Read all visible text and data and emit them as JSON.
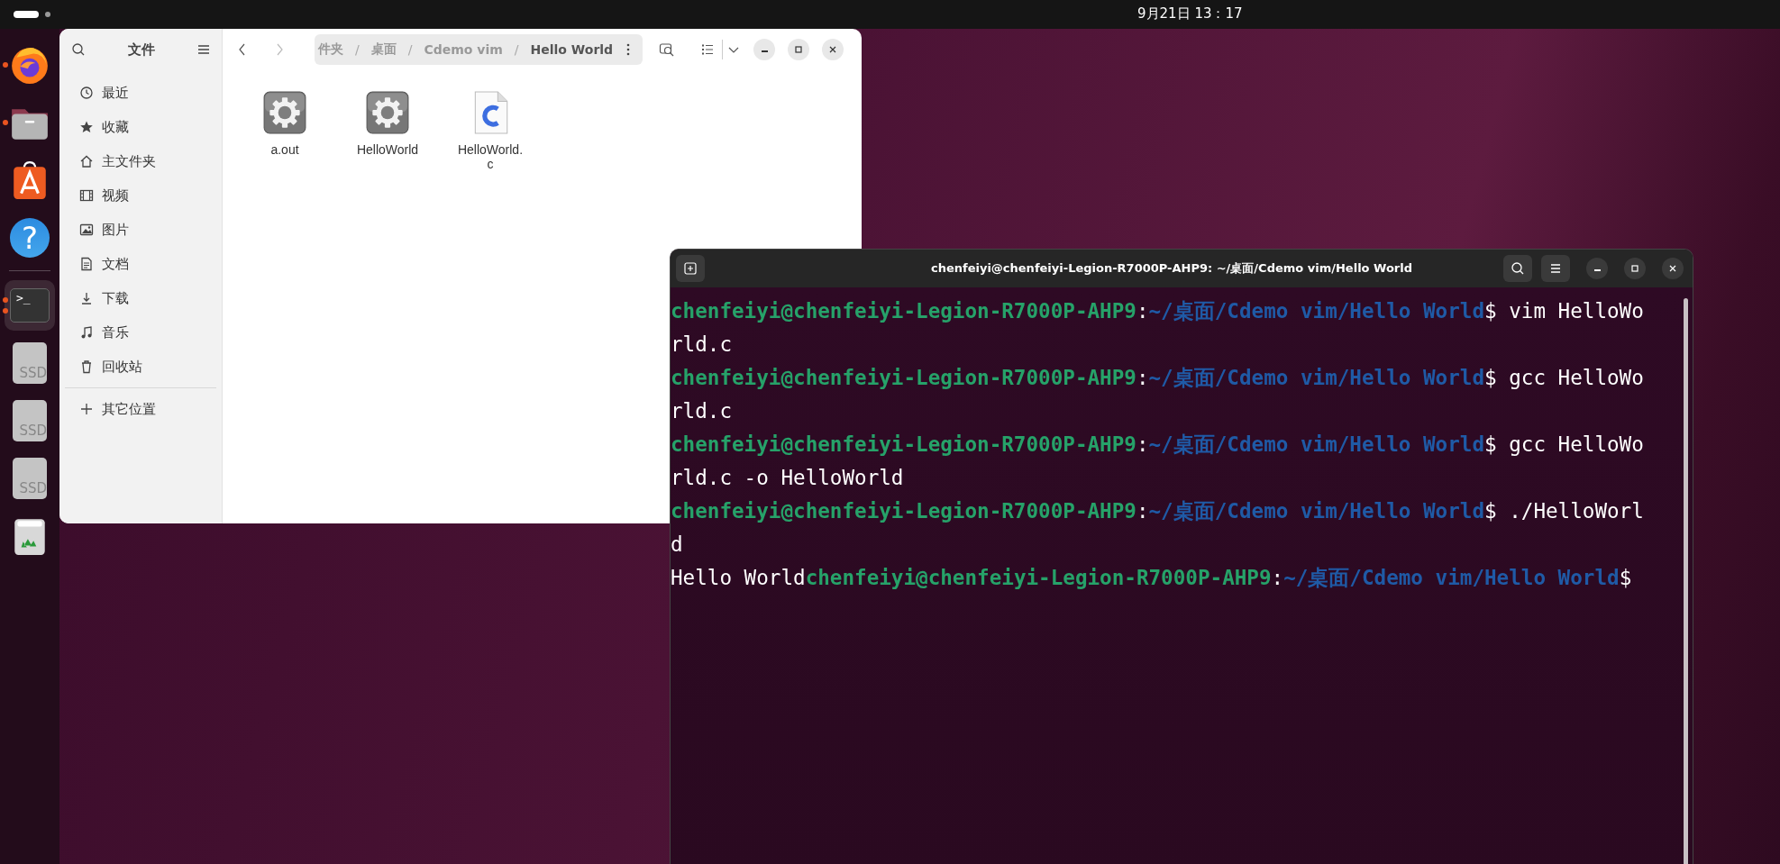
{
  "top_bar": {
    "clock": "9月21日 13：17"
  },
  "dock": {
    "items": [
      {
        "kind": "firefox",
        "running": true,
        "multiple": false,
        "selected": false
      },
      {
        "kind": "files",
        "running": true,
        "multiple": false,
        "selected": false
      },
      {
        "kind": "software",
        "running": false,
        "multiple": false,
        "selected": false
      },
      {
        "kind": "help",
        "glyph": "?",
        "running": false,
        "multiple": false,
        "selected": false
      },
      {
        "kind": "separator"
      },
      {
        "kind": "terminal",
        "glyph": ">_",
        "running": true,
        "multiple": true,
        "selected": true
      },
      {
        "kind": "drive",
        "label": "SSD",
        "running": false,
        "multiple": false,
        "selected": false
      },
      {
        "kind": "drive",
        "label": "SSD",
        "running": false,
        "multiple": false,
        "selected": false
      },
      {
        "kind": "drive",
        "label": "SSD",
        "running": false,
        "multiple": false,
        "selected": false
      },
      {
        "kind": "trash",
        "running": false,
        "multiple": false,
        "selected": false
      }
    ]
  },
  "file_manager": {
    "sidebar_title": "文件",
    "places": [
      {
        "label": "最近",
        "selected": false
      },
      {
        "label": "收藏",
        "selected": false
      },
      {
        "label": "主文件夹",
        "selected": false
      },
      {
        "label": "视频",
        "selected": false
      },
      {
        "label": "图片",
        "selected": false
      },
      {
        "label": "文档",
        "selected": false
      },
      {
        "label": "下载",
        "selected": false
      },
      {
        "label": "音乐",
        "selected": false
      },
      {
        "label": "回收站",
        "selected": false
      }
    ],
    "other_locations": "其它位置",
    "path": [
      {
        "label": "件夹",
        "current": false
      },
      {
        "separator": "/",
        "label": "桌面",
        "current": false
      },
      {
        "separator": "/",
        "label": "Cdemo vim",
        "current": false
      },
      {
        "separator": "/",
        "label": "Hello World",
        "current": true
      }
    ],
    "files": [
      {
        "name": "a.out",
        "kind": "executable"
      },
      {
        "name": "HelloWorld",
        "kind": "executable"
      },
      {
        "name": "HelloWorld.c",
        "kind": "c-source"
      }
    ]
  },
  "terminal": {
    "title": "chenfeiyi@chenfeiyi-Legion-R7000P-AHP9: ~/桌面/Cdemo vim/Hello World",
    "lines": [
      [
        {
          "kind": "user",
          "text": "chenfeiyi@chenfeiyi-Legion-R7000P-AHP9"
        },
        {
          "kind": "plain",
          "text": ":"
        },
        {
          "kind": "path",
          "text": "~/桌面/Cdemo vim/Hello World"
        },
        {
          "kind": "plain",
          "text": "$ vim HelloWo"
        }
      ],
      [
        {
          "kind": "plain",
          "text": "rld.c"
        }
      ],
      [
        {
          "kind": "user",
          "text": "chenfeiyi@chenfeiyi-Legion-R7000P-AHP9"
        },
        {
          "kind": "plain",
          "text": ":"
        },
        {
          "kind": "path",
          "text": "~/桌面/Cdemo vim/Hello World"
        },
        {
          "kind": "plain",
          "text": "$ gcc HelloWo"
        }
      ],
      [
        {
          "kind": "plain",
          "text": "rld.c"
        }
      ],
      [
        {
          "kind": "user",
          "text": "chenfeiyi@chenfeiyi-Legion-R7000P-AHP9"
        },
        {
          "kind": "plain",
          "text": ":"
        },
        {
          "kind": "path",
          "text": "~/桌面/Cdemo vim/Hello World"
        },
        {
          "kind": "plain",
          "text": "$ gcc HelloWo"
        }
      ],
      [
        {
          "kind": "plain",
          "text": "rld.c -o HelloWorld"
        }
      ],
      [
        {
          "kind": "user",
          "text": "chenfeiyi@chenfeiyi-Legion-R7000P-AHP9"
        },
        {
          "kind": "plain",
          "text": ":"
        },
        {
          "kind": "path",
          "text": "~/桌面/Cdemo vim/Hello World"
        },
        {
          "kind": "plain",
          "text": "$ ./HelloWorl"
        }
      ],
      [
        {
          "kind": "plain",
          "text": "d"
        }
      ],
      [
        {
          "kind": "plain",
          "text": "Hello World"
        },
        {
          "kind": "user",
          "text": "chenfeiyi@chenfeiyi-Legion-R7000P-AHP9"
        },
        {
          "kind": "plain",
          "text": ":"
        },
        {
          "kind": "path",
          "text": "~/桌面/Cdemo vim/Hello World"
        },
        {
          "kind": "plain",
          "text": "$"
        }
      ]
    ]
  }
}
